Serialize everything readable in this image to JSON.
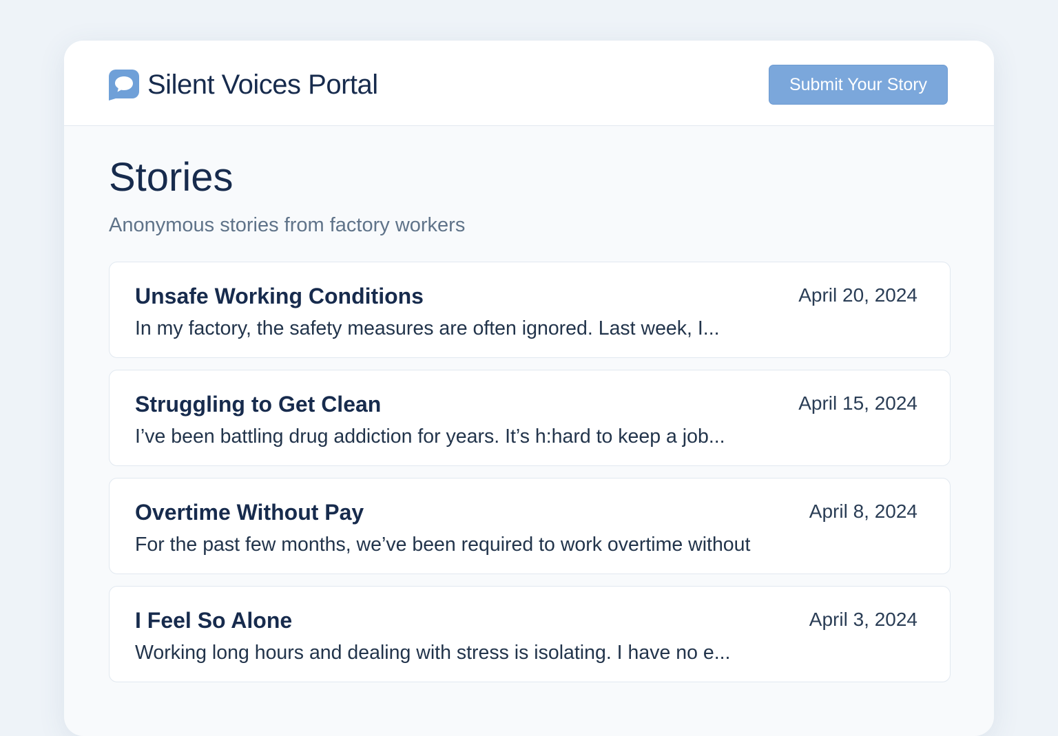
{
  "header": {
    "app_title": "Silent Voices Portal",
    "logo_icon": "speech-bubble-icon",
    "submit_label": "Submit Your Story"
  },
  "page": {
    "title": "Stories",
    "subtitle": "Anonymous  stories from factory workers"
  },
  "stories": [
    {
      "title": "Unsafe Working Conditions",
      "date": "April 20, 2024",
      "excerpt": "In my factory, the safety measures are often ignored. Last week, I..."
    },
    {
      "title": "Struggling to Get Clean",
      "date": "April 15, 2024",
      "excerpt": "I’ve been battling drug addiction for years. It’s h:hard to keep a job..."
    },
    {
      "title": "Overtime Without Pay",
      "date": "April 8, 2024",
      "excerpt": "For the past few months, we’ve been required to work overtime without"
    },
    {
      "title": "I Feel So Alone",
      "date": "April 3, 2024",
      "excerpt": "Working long hours and dealing with stress is isolating. I have no e..."
    }
  ],
  "colors": {
    "accent": "#7ba7db",
    "title_text": "#172b4d",
    "subtitle_text": "#5f7389",
    "background": "#eef3f8"
  }
}
